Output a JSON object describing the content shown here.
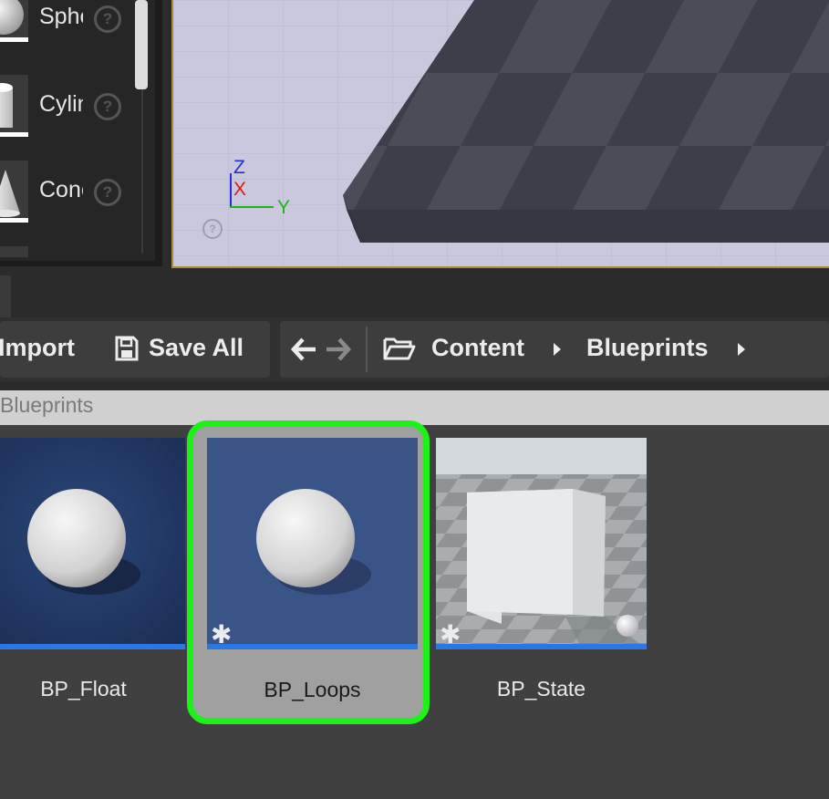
{
  "place_panel": {
    "items": [
      {
        "label": "Sphe",
        "icon": "sphere-icon"
      },
      {
        "label": "Cylin",
        "icon": "cylinder-icon"
      },
      {
        "label": "Cone",
        "icon": "cone-icon"
      }
    ],
    "help_glyph": "?"
  },
  "viewport": {
    "axis_z": "Z",
    "axis_x": "X",
    "axis_y": "Y",
    "help_glyph": "?"
  },
  "toolbar": {
    "import_label": "Import",
    "save_all_label": "Save All",
    "breadcrumbs": [
      "Content",
      "Blueprints"
    ]
  },
  "path_bar": {
    "text": "Blueprints"
  },
  "assets": [
    {
      "name": "BP_Float",
      "selected": false,
      "thumbnail": "sphere"
    },
    {
      "name": "BP_Loops",
      "selected": true,
      "thumbnail": "sphere"
    },
    {
      "name": "BP_State",
      "selected": false,
      "thumbnail": "cube"
    }
  ],
  "colors": {
    "selection_highlight": "#1ef11a",
    "asset_underline": "#2b78e4",
    "axis_z": "#2b2bd8",
    "axis_x": "#e01818",
    "axis_y": "#1fb31f"
  }
}
